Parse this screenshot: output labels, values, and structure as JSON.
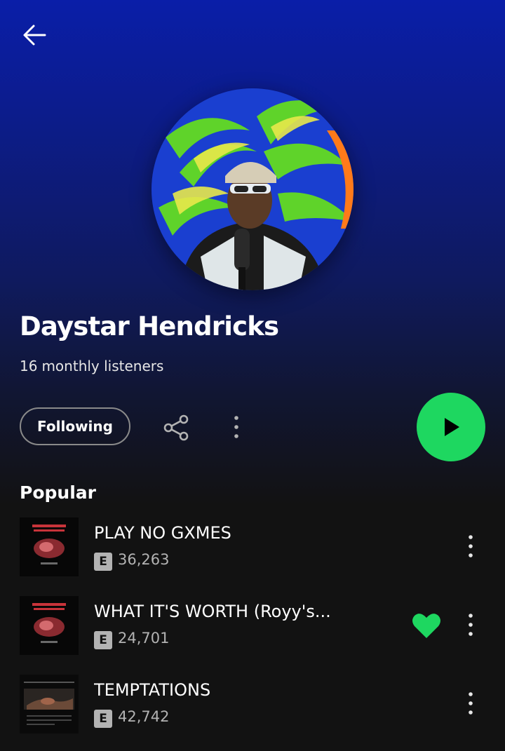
{
  "header": {
    "back_icon": "arrow-left-icon"
  },
  "artist": {
    "name": "Daystar Hendricks",
    "monthly_listeners": "16",
    "monthly_listeners_label": "monthly listeners"
  },
  "actions": {
    "follow_label": "Following",
    "share_icon": "share-icon",
    "more_icon": "more-vertical-icon",
    "play_icon": "play-icon",
    "play_color": "#1ed760"
  },
  "popular": {
    "title": "Popular",
    "tracks": [
      {
        "title": "PLAY NO GXMES",
        "explicit": "E",
        "plays": "36,263",
        "liked": false
      },
      {
        "title": "WHAT IT'S WORTH (Royy's...",
        "explicit": "E",
        "plays": "24,701",
        "liked": true
      },
      {
        "title": "TEMPTATIONS",
        "explicit": "E",
        "plays": "42,742",
        "liked": false
      }
    ]
  },
  "colors": {
    "accent": "#1ed760",
    "background": "#121212",
    "header_gradient_top": "#0a1ea8",
    "text_secondary": "#b3b3b3"
  }
}
